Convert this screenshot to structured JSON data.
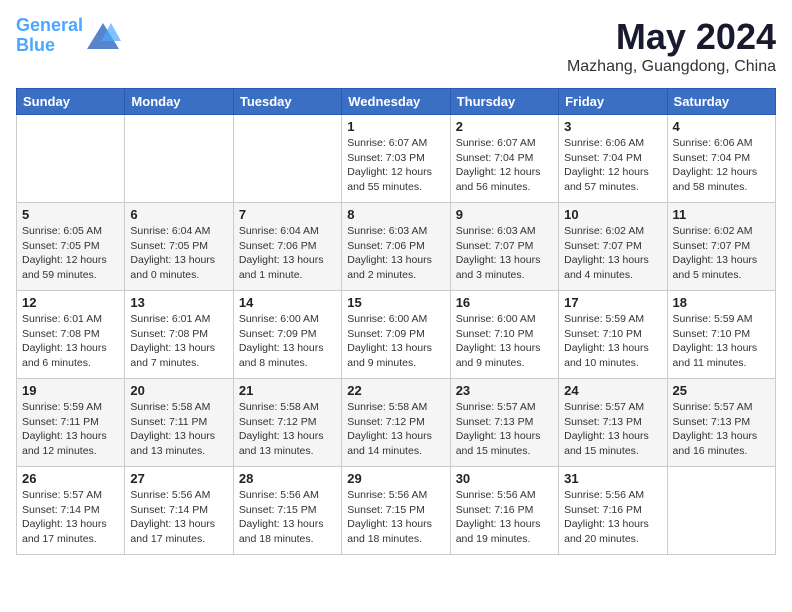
{
  "header": {
    "logo_line1": "General",
    "logo_line2": "Blue",
    "title": "May 2024",
    "subtitle": "Mazhang, Guangdong, China"
  },
  "weekdays": [
    "Sunday",
    "Monday",
    "Tuesday",
    "Wednesday",
    "Thursday",
    "Friday",
    "Saturday"
  ],
  "weeks": [
    [
      {
        "day": "",
        "info": ""
      },
      {
        "day": "",
        "info": ""
      },
      {
        "day": "",
        "info": ""
      },
      {
        "day": "1",
        "info": "Sunrise: 6:07 AM\nSunset: 7:03 PM\nDaylight: 12 hours\nand 55 minutes."
      },
      {
        "day": "2",
        "info": "Sunrise: 6:07 AM\nSunset: 7:04 PM\nDaylight: 12 hours\nand 56 minutes."
      },
      {
        "day": "3",
        "info": "Sunrise: 6:06 AM\nSunset: 7:04 PM\nDaylight: 12 hours\nand 57 minutes."
      },
      {
        "day": "4",
        "info": "Sunrise: 6:06 AM\nSunset: 7:04 PM\nDaylight: 12 hours\nand 58 minutes."
      }
    ],
    [
      {
        "day": "5",
        "info": "Sunrise: 6:05 AM\nSunset: 7:05 PM\nDaylight: 12 hours\nand 59 minutes."
      },
      {
        "day": "6",
        "info": "Sunrise: 6:04 AM\nSunset: 7:05 PM\nDaylight: 13 hours\nand 0 minutes."
      },
      {
        "day": "7",
        "info": "Sunrise: 6:04 AM\nSunset: 7:06 PM\nDaylight: 13 hours\nand 1 minute."
      },
      {
        "day": "8",
        "info": "Sunrise: 6:03 AM\nSunset: 7:06 PM\nDaylight: 13 hours\nand 2 minutes."
      },
      {
        "day": "9",
        "info": "Sunrise: 6:03 AM\nSunset: 7:07 PM\nDaylight: 13 hours\nand 3 minutes."
      },
      {
        "day": "10",
        "info": "Sunrise: 6:02 AM\nSunset: 7:07 PM\nDaylight: 13 hours\nand 4 minutes."
      },
      {
        "day": "11",
        "info": "Sunrise: 6:02 AM\nSunset: 7:07 PM\nDaylight: 13 hours\nand 5 minutes."
      }
    ],
    [
      {
        "day": "12",
        "info": "Sunrise: 6:01 AM\nSunset: 7:08 PM\nDaylight: 13 hours\nand 6 minutes."
      },
      {
        "day": "13",
        "info": "Sunrise: 6:01 AM\nSunset: 7:08 PM\nDaylight: 13 hours\nand 7 minutes."
      },
      {
        "day": "14",
        "info": "Sunrise: 6:00 AM\nSunset: 7:09 PM\nDaylight: 13 hours\nand 8 minutes."
      },
      {
        "day": "15",
        "info": "Sunrise: 6:00 AM\nSunset: 7:09 PM\nDaylight: 13 hours\nand 9 minutes."
      },
      {
        "day": "16",
        "info": "Sunrise: 6:00 AM\nSunset: 7:10 PM\nDaylight: 13 hours\nand 9 minutes."
      },
      {
        "day": "17",
        "info": "Sunrise: 5:59 AM\nSunset: 7:10 PM\nDaylight: 13 hours\nand 10 minutes."
      },
      {
        "day": "18",
        "info": "Sunrise: 5:59 AM\nSunset: 7:10 PM\nDaylight: 13 hours\nand 11 minutes."
      }
    ],
    [
      {
        "day": "19",
        "info": "Sunrise: 5:59 AM\nSunset: 7:11 PM\nDaylight: 13 hours\nand 12 minutes."
      },
      {
        "day": "20",
        "info": "Sunrise: 5:58 AM\nSunset: 7:11 PM\nDaylight: 13 hours\nand 13 minutes."
      },
      {
        "day": "21",
        "info": "Sunrise: 5:58 AM\nSunset: 7:12 PM\nDaylight: 13 hours\nand 13 minutes."
      },
      {
        "day": "22",
        "info": "Sunrise: 5:58 AM\nSunset: 7:12 PM\nDaylight: 13 hours\nand 14 minutes."
      },
      {
        "day": "23",
        "info": "Sunrise: 5:57 AM\nSunset: 7:13 PM\nDaylight: 13 hours\nand 15 minutes."
      },
      {
        "day": "24",
        "info": "Sunrise: 5:57 AM\nSunset: 7:13 PM\nDaylight: 13 hours\nand 15 minutes."
      },
      {
        "day": "25",
        "info": "Sunrise: 5:57 AM\nSunset: 7:13 PM\nDaylight: 13 hours\nand 16 minutes."
      }
    ],
    [
      {
        "day": "26",
        "info": "Sunrise: 5:57 AM\nSunset: 7:14 PM\nDaylight: 13 hours\nand 17 minutes."
      },
      {
        "day": "27",
        "info": "Sunrise: 5:56 AM\nSunset: 7:14 PM\nDaylight: 13 hours\nand 17 minutes."
      },
      {
        "day": "28",
        "info": "Sunrise: 5:56 AM\nSunset: 7:15 PM\nDaylight: 13 hours\nand 18 minutes."
      },
      {
        "day": "29",
        "info": "Sunrise: 5:56 AM\nSunset: 7:15 PM\nDaylight: 13 hours\nand 18 minutes."
      },
      {
        "day": "30",
        "info": "Sunrise: 5:56 AM\nSunset: 7:16 PM\nDaylight: 13 hours\nand 19 minutes."
      },
      {
        "day": "31",
        "info": "Sunrise: 5:56 AM\nSunset: 7:16 PM\nDaylight: 13 hours\nand 20 minutes."
      },
      {
        "day": "",
        "info": ""
      }
    ]
  ]
}
